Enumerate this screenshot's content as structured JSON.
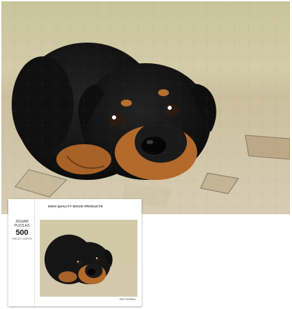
{
  "product": {
    "brand_text": "HIGH QUALITY WOOD PRODUCTS",
    "jigsaw_label": "JIGSAW PUZZLES",
    "piece_count": "500",
    "piece_unit": "PIECES / 500PCS",
    "size_text": "SIZE 52X38cm"
  },
  "colors": {
    "background": "#ffffff",
    "puppy_fur": "#141414",
    "puppy_tan": "#b46a2a",
    "ground": "#cfc4a4"
  }
}
